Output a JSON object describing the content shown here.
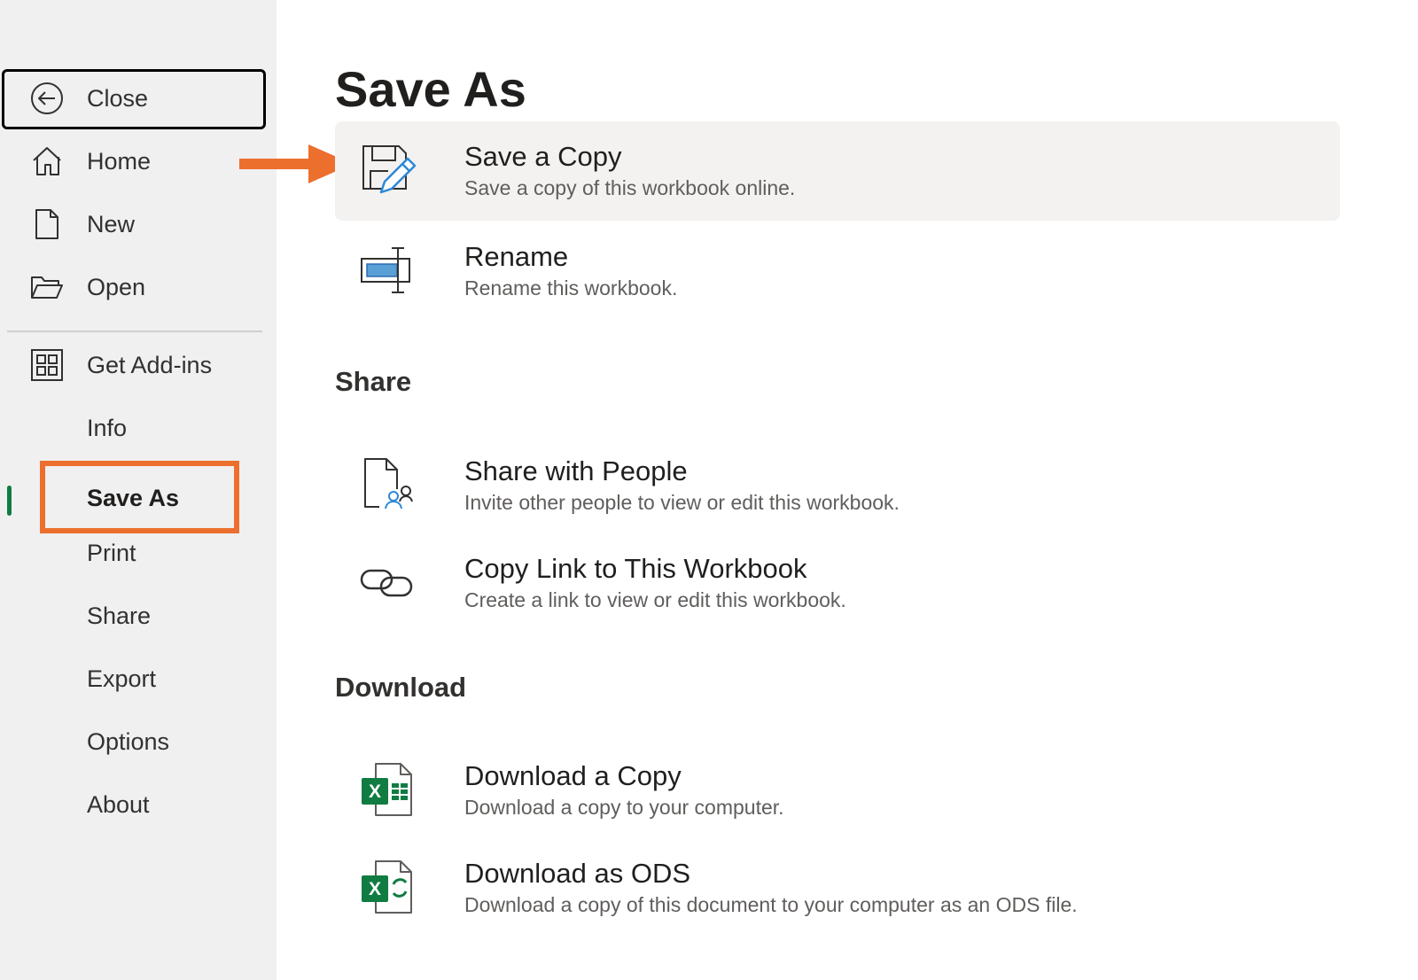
{
  "sidebar": {
    "close_label": "Close",
    "items": [
      {
        "label": "Home",
        "icon": "home-icon"
      },
      {
        "label": "New",
        "icon": "new-document-icon"
      },
      {
        "label": "Open",
        "icon": "open-folder-icon"
      },
      {
        "label": "Get Add-ins",
        "icon": "add-ins-grid-icon"
      },
      {
        "label": "Info"
      },
      {
        "label": "Save As",
        "active": true
      },
      {
        "label": "Print"
      },
      {
        "label": "Share"
      },
      {
        "label": "Export"
      },
      {
        "label": "Options"
      },
      {
        "label": "About"
      }
    ]
  },
  "main": {
    "title": "Save As",
    "save_options": [
      {
        "title": "Save a Copy",
        "desc": "Save a copy of this workbook online.",
        "icon": "save-copy-icon"
      },
      {
        "title": "Rename",
        "desc": "Rename this workbook.",
        "icon": "rename-icon"
      }
    ],
    "share_heading": "Share",
    "share_options": [
      {
        "title": "Share with People",
        "desc": "Invite other people to view or edit this workbook.",
        "icon": "share-people-icon"
      },
      {
        "title": "Copy Link to This Workbook",
        "desc": "Create a link to view or edit this workbook.",
        "icon": "link-icon"
      }
    ],
    "download_heading": "Download",
    "download_options": [
      {
        "title": "Download a Copy",
        "desc": "Download a copy to your computer.",
        "icon": "excel-file-icon"
      },
      {
        "title": "Download as ODS",
        "desc": "Download a copy of this document to your computer as an ODS file.",
        "icon": "excel-ods-icon"
      }
    ]
  },
  "colors": {
    "annotation_orange": "#ec6f2e",
    "active_green": "#107c41",
    "excel_green": "#107c41",
    "accent_blue": "#2b88d8"
  }
}
